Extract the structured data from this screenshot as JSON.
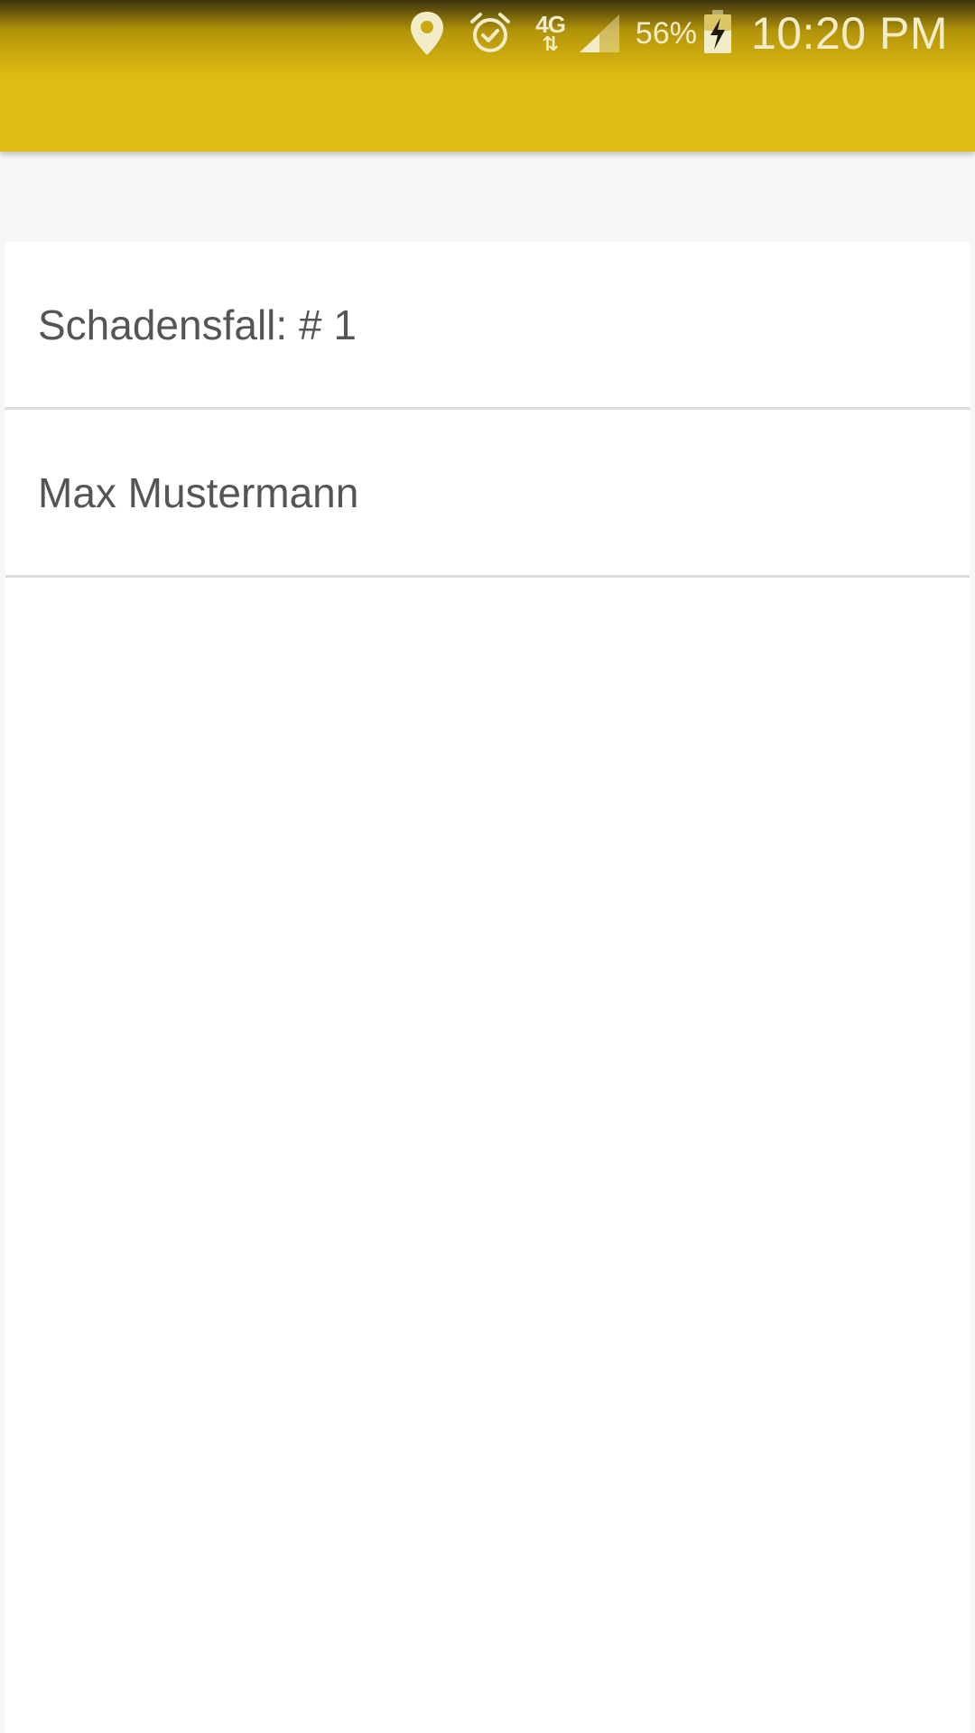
{
  "status_bar": {
    "icons": [
      "location-pin-icon",
      "alarm-icon",
      "network-4g-icon",
      "signal-icon",
      "battery-charging-icon"
    ],
    "network_type": "4G",
    "battery_percent": "56%",
    "time": "10:20 PM"
  },
  "app_bar": {
    "color": "#dfbc14"
  },
  "list": {
    "items": [
      {
        "label": "Schadensfall: # 1"
      },
      {
        "label": "Max Mustermann"
      }
    ]
  }
}
